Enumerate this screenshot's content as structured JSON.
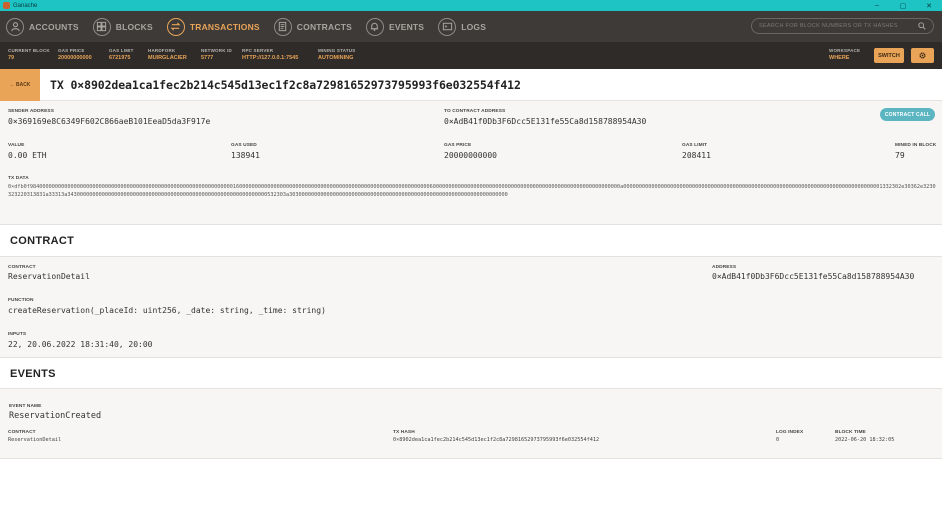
{
  "window": {
    "title": "Ganache",
    "min": "–",
    "max": "▢",
    "close": "✕"
  },
  "nav": {
    "items": [
      {
        "label": "ACCOUNTS"
      },
      {
        "label": "BLOCKS"
      },
      {
        "label": "TRANSACTIONS"
      },
      {
        "label": "CONTRACTS"
      },
      {
        "label": "EVENTS"
      },
      {
        "label": "LOGS"
      }
    ],
    "search_placeholder": "SEARCH FOR BLOCK NUMBERS OR TX HASHES"
  },
  "status": {
    "current_block": {
      "label": "CURRENT BLOCK",
      "value": "79"
    },
    "gas_price": {
      "label": "GAS PRICE",
      "value": "20000000000"
    },
    "gas_limit": {
      "label": "GAS LIMIT",
      "value": "6721975"
    },
    "hardfork": {
      "label": "HARDFORK",
      "value": "MUIRGLACIER"
    },
    "network_id": {
      "label": "NETWORK ID",
      "value": "5777"
    },
    "rpc_server": {
      "label": "RPC SERVER",
      "value": "HTTP://127.0.0.1:7545"
    },
    "mining_status": {
      "label": "MINING STATUS",
      "value": "AUTOMINING"
    },
    "workspace": {
      "label": "WORKSPACE",
      "value": "WHERE"
    },
    "switch_label": "SWITCH"
  },
  "tx": {
    "back_label": "← BACK",
    "title": "TX 0×8902dea1ca1fec2b214c545d13ec1f2c8a72981652973795993f6e032554f412",
    "sender": {
      "label": "SENDER ADDRESS",
      "value": "0×369169e8C6349F602C866aeB101EeaD5da3F917e"
    },
    "to_contract": {
      "label": "TO CONTRACT ADDRESS",
      "value": "0×AdB41f0Db3F6Dcc5E131fe55Ca8d158788954A30"
    },
    "call_badge": "CONTRACT CALL",
    "value": {
      "label": "VALUE",
      "value": "0.00 ETH"
    },
    "gas_used": {
      "label": "GAS USED",
      "value": "138941"
    },
    "gas_price": {
      "label": "GAS PRICE",
      "value": "20000000000"
    },
    "gas_limit": {
      "label": "GAS LIMIT",
      "value": "208411"
    },
    "mined_in_block": {
      "label": "MINED IN BLOCK",
      "value": "79"
    },
    "tx_data": {
      "label": "TX DATA",
      "value": "0×dfb0f984000000000000000000000000000000000000000000000000000000000000001600000000000000000000000000000000000000000000000000000000000006000000000000000000000000000000000000000000000000000000000000a00000000000000000000000000000000000000000000000000000000000000000000000000000000001332302e30362e3230323220313831a33313a3430000000000000000000000000000000000000000000000000000000000000532303a3030000000000000000000000000000000000000000000000000000000000000000000"
    }
  },
  "contract": {
    "heading": "CONTRACT",
    "name_label": "CONTRACT",
    "name": "ReservationDetail",
    "address_label": "ADDRESS",
    "address": "0×AdB41f0Db3F6Dcc5E131fe55Ca8d158788954A30",
    "function_label": "FUNCTION",
    "function": "createReservation(_placeId: uint256, _date: string, _time: string)",
    "inputs_label": "INPUTS",
    "inputs": "22, 20.06.2022 18:31:40, 20:00"
  },
  "events": {
    "heading": "EVENTS",
    "event_name_label": "EVENT NAME",
    "event_name": "ReservationCreated",
    "contract_label": "CONTRACT",
    "contract": "ReservationDetail",
    "tx_hash_label": "TX HASH",
    "tx_hash": "0×8902dea1ca1fec2b214c545d13ec1f2c8a72981652973795993f6e032554f412",
    "log_index_label": "LOG INDEX",
    "log_index": "0",
    "block_time_label": "BLOCK TIME",
    "block_time": "2022-06-20 18:32:05"
  },
  "colors": {
    "accent": "#e9a458",
    "titlebar": "#1ec3c4",
    "nav_bg": "#3d3a37",
    "status_bg": "#2e2b29",
    "badge": "#5bb6c2"
  }
}
